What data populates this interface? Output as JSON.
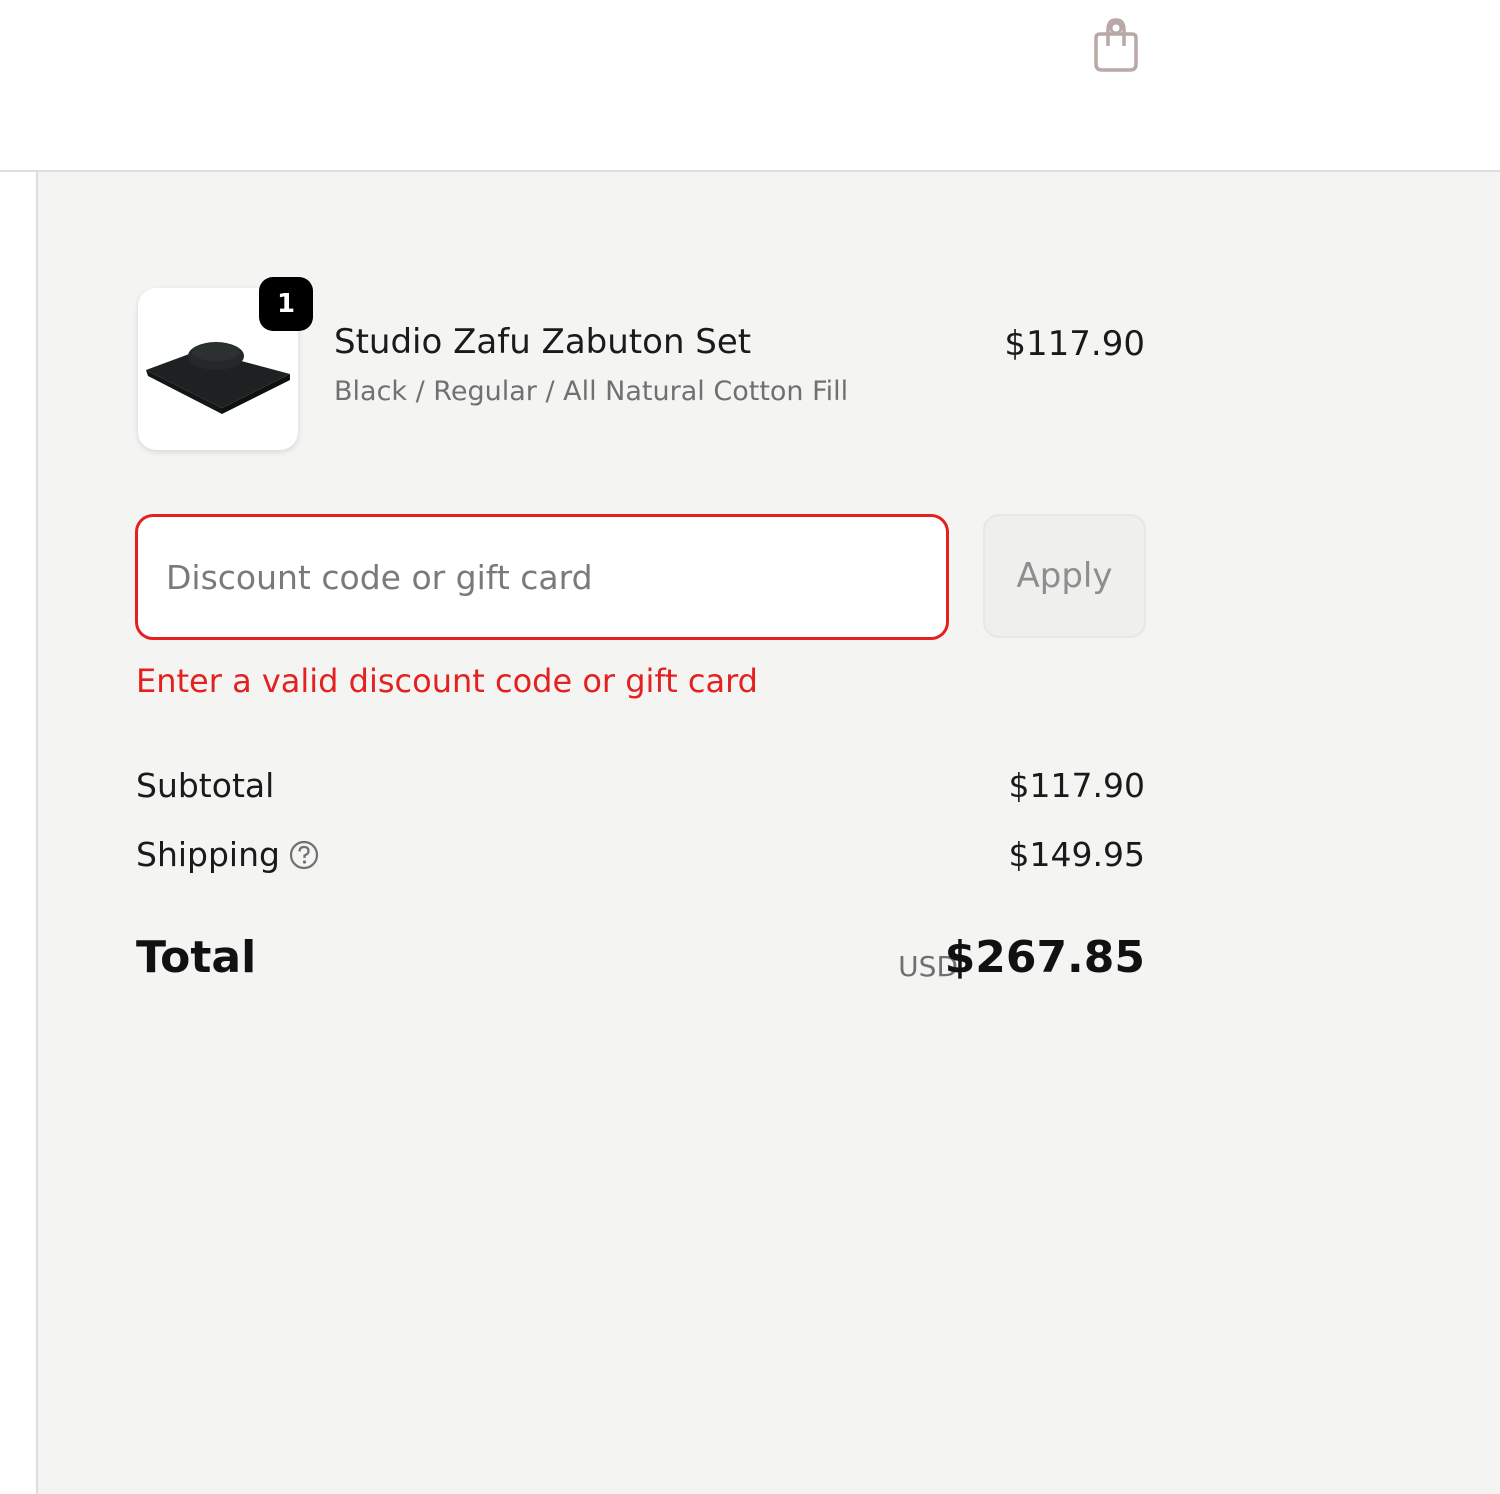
{
  "header": {
    "cart_icon": "shopping-bag-icon"
  },
  "product": {
    "quantity": "1",
    "name": "Studio Zafu Zabuton Set",
    "variant": "Black / Regular / All Natural Cotton Fill",
    "price": "$117.90",
    "image_icon": "zafu-cushion-image"
  },
  "discount": {
    "placeholder": "Discount code or gift card",
    "value": "",
    "apply_label": "Apply",
    "error": "Enter a valid discount code or gift card"
  },
  "summary": {
    "subtotal_label": "Subtotal",
    "subtotal_value": "$117.90",
    "shipping_label": "Shipping",
    "shipping_value": "$149.95",
    "total_label": "Total",
    "currency": "USD",
    "total_value": "$267.85"
  },
  "colors": {
    "error": "#e22120",
    "summary_bg": "#f4f4f3",
    "badge_bg": "#000000"
  }
}
